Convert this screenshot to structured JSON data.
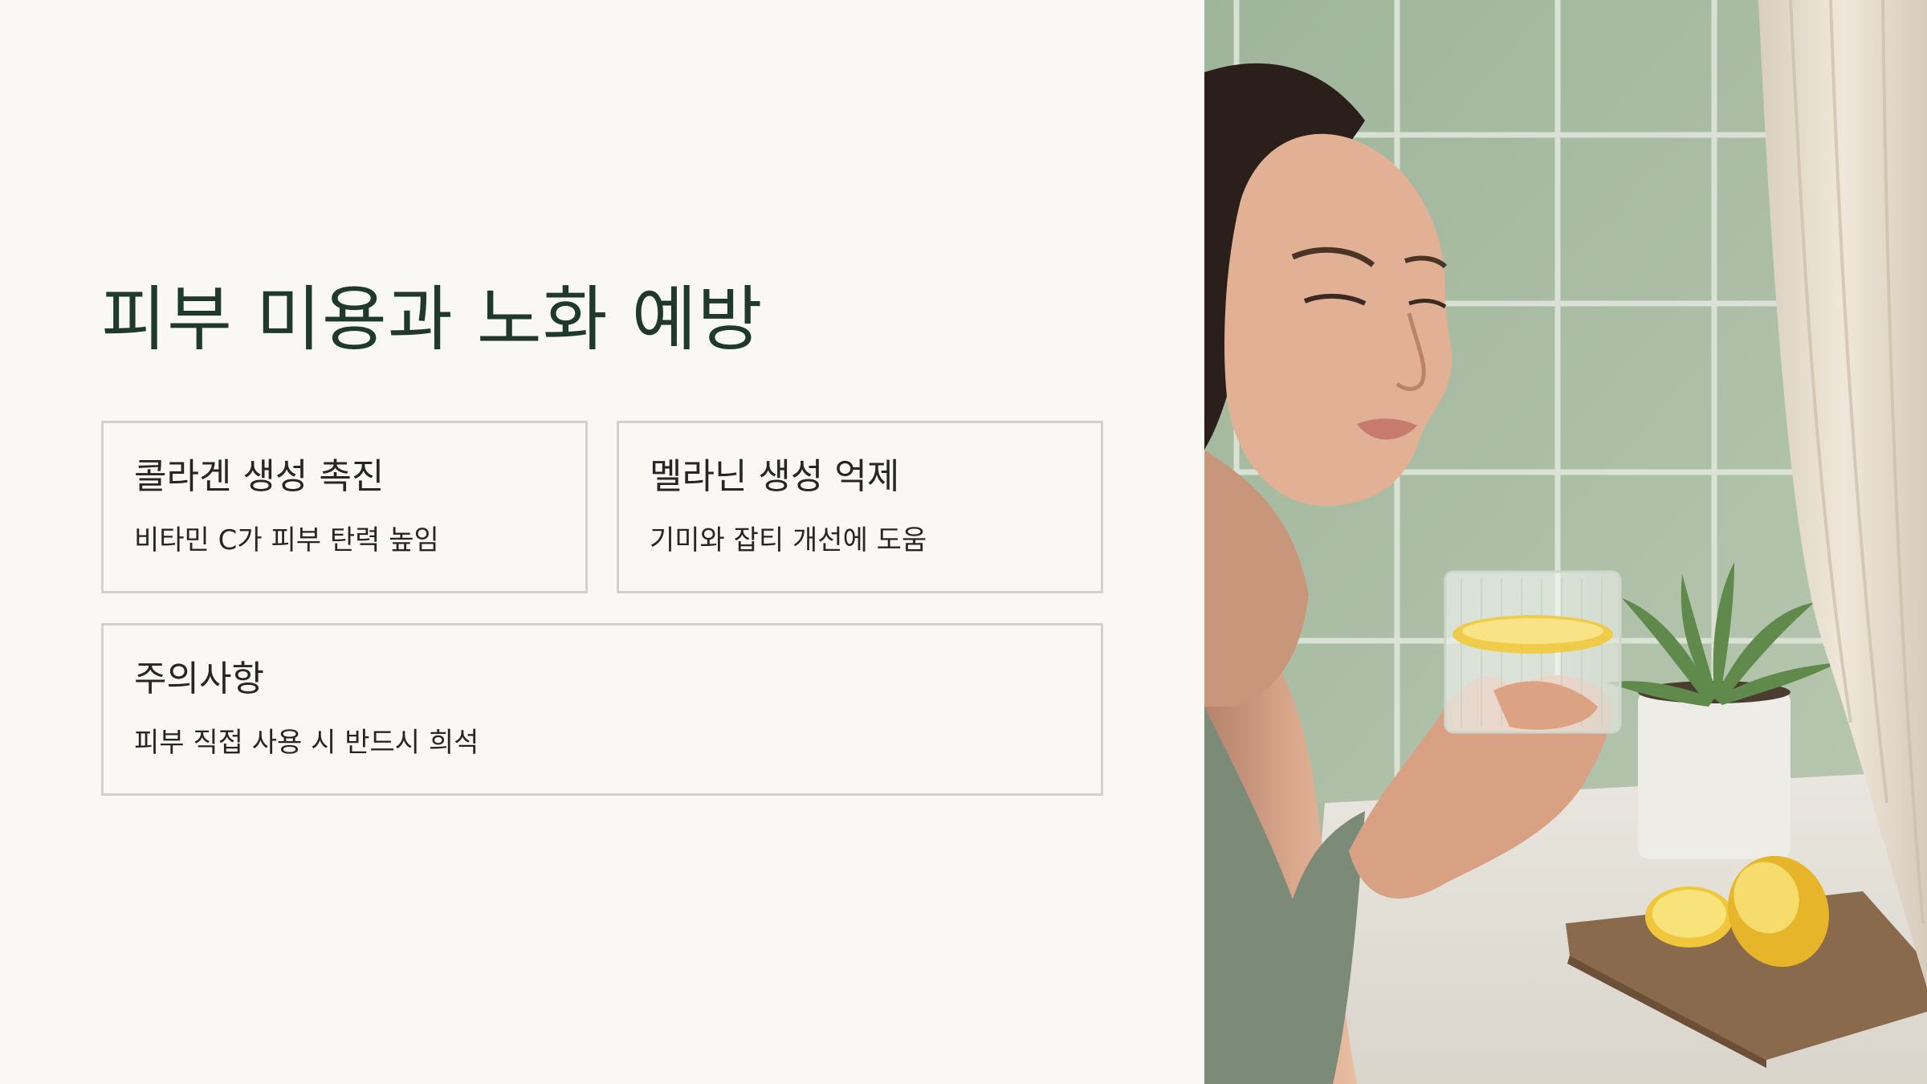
{
  "slide": {
    "title": "피부 미용과 노화 예방",
    "cards": [
      {
        "heading": "콜라겐 생성 촉진",
        "description": "비타민 C가 피부 탄력 높임"
      },
      {
        "heading": "멜라닌 생성 억제",
        "description": "기미와 잡티 개선에 도움"
      },
      {
        "heading": "주의사항",
        "description": "피부 직접 사용 시 반드시 희석"
      }
    ]
  },
  "colors": {
    "background": "#f9f8f4",
    "title": "#1f3a2d",
    "card_border": "#d3d1cb",
    "text": "#262626",
    "tile_green": "#a9bca3"
  },
  "photo": {
    "subject": "woman-holding-lemon-water-glass"
  }
}
